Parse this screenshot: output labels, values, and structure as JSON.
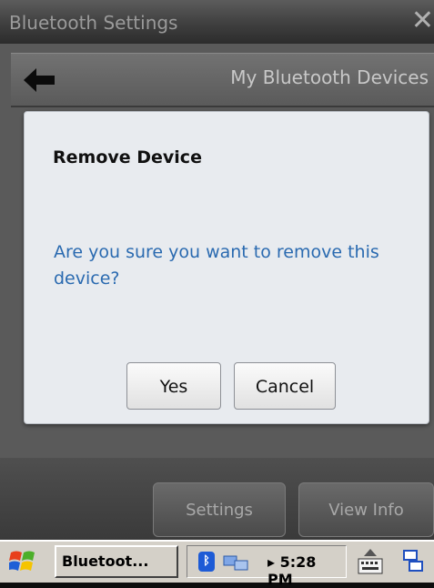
{
  "window": {
    "title": "Bluetooth Settings",
    "close_glyph": "✕"
  },
  "nav": {
    "heading": "My Bluetooth Devices",
    "back_icon": "arrow-left-icon"
  },
  "dialog": {
    "title": "Remove Device",
    "message": "Are you sure you want to remove this device?",
    "yes_label": "Yes",
    "cancel_label": "Cancel"
  },
  "softkeys": {
    "left_label": "Settings",
    "right_label": "View Info"
  },
  "taskbar": {
    "task_label": "Bluetoot...",
    "clock": "▸ 5:28 PM",
    "icons": [
      "windows-start-icon",
      "bluetooth-icon",
      "network-icon",
      "keyboard-icon",
      "input-panel-icon"
    ]
  },
  "colors": {
    "dialog_bg": "#e8ebef",
    "message_text": "#2a6ab0",
    "app_bg": "#5a5a5a"
  }
}
